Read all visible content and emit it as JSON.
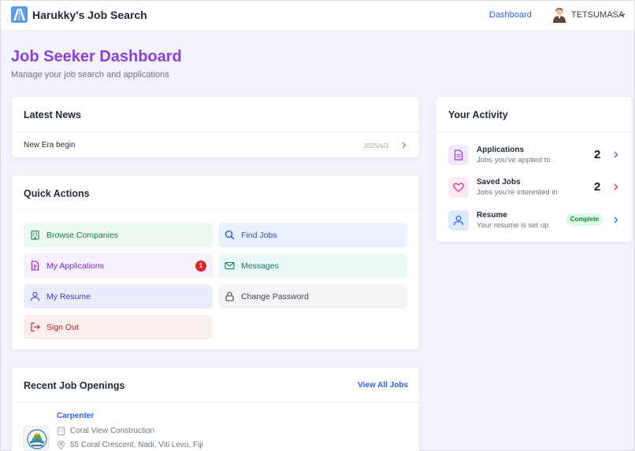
{
  "header": {
    "app_title": "Harukky's Job Search",
    "nav_dashboard": "Dashboard",
    "username": "TETSUMASA"
  },
  "page": {
    "title": "Job Seeker Dashboard",
    "subtitle": "Manage your job search and applications"
  },
  "news": {
    "title": "Latest News",
    "items": [
      {
        "title": "New Era begin",
        "date": "2025/6/3"
      }
    ]
  },
  "quick_actions": {
    "title": "Quick Actions",
    "buttons": [
      {
        "label": "Browse Companies",
        "icon": "building-icon",
        "color": "#15803d",
        "bg": "#ecf9f0"
      },
      {
        "label": "Find Jobs",
        "icon": "search-icon",
        "color": "#1d4ed8",
        "bg": "#eaf1fe"
      },
      {
        "label": "My Applications",
        "icon": "document-icon",
        "color": "#7e22ce",
        "bg": "#f7f0fd",
        "badge": "1"
      },
      {
        "label": "Messages",
        "icon": "mail-icon",
        "color": "#0f766e",
        "bg": "#e8f8f5"
      },
      {
        "label": "My Resume",
        "icon": "user-icon",
        "color": "#4338ca",
        "bg": "#ebedfc"
      },
      {
        "label": "Change Password",
        "icon": "lock-icon",
        "color": "#374151",
        "bg": "#f5f5f6"
      },
      {
        "label": "Sign Out",
        "icon": "sign-out-icon",
        "color": "#b91c1c",
        "bg": "#fdeeee"
      }
    ]
  },
  "recent_jobs": {
    "title": "Recent Job Openings",
    "view_all": "View All Jobs",
    "items": [
      {
        "title": "Carpenter",
        "company": "Coral View Construction",
        "location": "55 Coral Crescent, Nadi, Viti Levu, Fiji"
      }
    ]
  },
  "activity": {
    "title": "Your Activity",
    "rows": [
      {
        "label": "Applications",
        "sub": "Jobs you've applied to",
        "count": "2",
        "icon": "document-icon",
        "color": "#9333ea",
        "bg": "#f3e8ff"
      },
      {
        "label": "Saved Jobs",
        "sub": "Jobs you're interested in",
        "count": "2",
        "icon": "heart-icon",
        "color": "#db2777",
        "bg": "#fce7f3"
      },
      {
        "label": "Resume",
        "sub": "Your resume is set up",
        "status": "Complete",
        "icon": "user-icon",
        "color": "#2563eb",
        "bg": "#dbeafe"
      }
    ]
  },
  "colors": {
    "accent_purple": "#8b3fd9",
    "link_blue": "#2563eb",
    "page_bg": "#f3f2fb"
  }
}
